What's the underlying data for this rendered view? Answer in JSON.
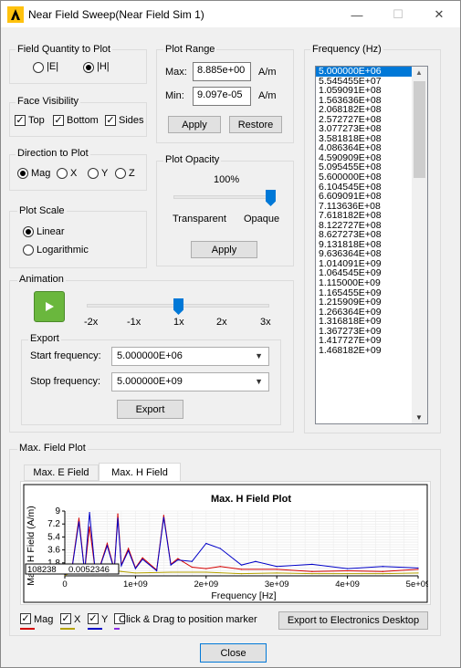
{
  "window": {
    "title": "Near Field Sweep(Near Field Sim 1)",
    "minimize": "—",
    "maximize": "☐",
    "close": "✕"
  },
  "field_quantity": {
    "title": "Field Quantity to Plot",
    "options": [
      "|E|",
      "|H|"
    ],
    "selected": "|H|"
  },
  "face_visibility": {
    "title": "Face Visibility",
    "options": [
      "Top",
      "Bottom",
      "Sides"
    ]
  },
  "direction": {
    "title": "Direction to Plot",
    "options": [
      "Mag",
      "X",
      "Y",
      "Z"
    ],
    "selected": "Mag"
  },
  "plot_scale": {
    "title": "Plot Scale",
    "options": [
      "Linear",
      "Logarithmic"
    ],
    "selected": "Linear"
  },
  "plot_range": {
    "title": "Plot Range",
    "max_label": "Max:",
    "max_value": "8.885e+00",
    "min_label": "Min:",
    "min_value": "9.097e-05",
    "unit": "A/m",
    "apply": "Apply",
    "restore": "Restore"
  },
  "plot_opacity": {
    "title": "Plot Opacity",
    "percent": "100%",
    "level": 1.0,
    "left_label": "Transparent",
    "right_label": "Opaque",
    "apply": "Apply"
  },
  "animation": {
    "title": "Animation",
    "speed_labels": [
      "-2x",
      "-1x",
      "1x",
      "2x",
      "3x"
    ],
    "speed": "1x",
    "export_title": "Export",
    "start_label": "Start frequency:",
    "start_value": "5.000000E+06",
    "stop_label": "Stop frequency:",
    "stop_value": "5.000000E+09",
    "export_button": "Export"
  },
  "frequency": {
    "title": "Frequency (Hz)",
    "items": [
      "5.000000E+06",
      "5.545455E+07",
      "1.059091E+08",
      "1.563636E+08",
      "2.068182E+08",
      "2.572727E+08",
      "3.077273E+08",
      "3.581818E+08",
      "4.086364E+08",
      "4.590909E+08",
      "5.095455E+08",
      "5.600000E+08",
      "6.104545E+08",
      "6.609091E+08",
      "7.113636E+08",
      "7.618182E+08",
      "8.122727E+08",
      "8.627273E+08",
      "9.131818E+08",
      "9.636364E+08",
      "1.014091E+09",
      "1.064545E+09",
      "1.115000E+09",
      "1.165455E+09",
      "1.215909E+09",
      "1.266364E+09",
      "1.316818E+09",
      "1.367273E+09",
      "1.417727E+09",
      "1.468182E+09"
    ],
    "selected_index": 0
  },
  "max_field": {
    "title": "Max. Field Plot",
    "tabs": [
      "Max. E Field",
      "Max. H Field"
    ],
    "active_tab": "Max. H Field",
    "legend": [
      {
        "label": "Mag",
        "color": "#d40000"
      },
      {
        "label": "X",
        "color": "#b5a200"
      },
      {
        "label": "Y",
        "color": "#0000c8"
      },
      {
        "label": "Click & Drag to position marker",
        "color": "#8a2be2"
      }
    ],
    "export_button": "Export to Electronics Desktop",
    "marker_readout": "0.0052346",
    "marker_x": "108238"
  },
  "chart_data": {
    "type": "line",
    "title": "Max. H Field Plot",
    "xlabel": "Frequency [Hz]",
    "ylabel": "Max. H Field (A/m)",
    "xlim": [
      0,
      5000000000
    ],
    "ylim": [
      0,
      9
    ],
    "x_ticks": [
      "0",
      "1e+09",
      "2e+09",
      "3e+09",
      "4e+09",
      "5e+09"
    ],
    "y_ticks": [
      "1.8",
      "3.6",
      "5.4",
      "7.2",
      "9"
    ],
    "grid": true,
    "series": [
      {
        "name": "Mag",
        "color": "#d40000",
        "x": [
          5000000.0,
          100000000.0,
          200000000.0,
          280000000.0,
          350000000.0,
          430000000.0,
          500000000.0,
          600000000.0,
          700000000.0,
          750000000.0,
          800000000.0,
          900000000.0,
          1000000000.0,
          1100000000.0,
          1300000000.0,
          1400000000.0,
          1500000000.0,
          1600000000.0,
          1800000000.0,
          2000000000.0,
          2200000000.0,
          2500000000.0,
          3000000000.0,
          3500000000.0,
          4000000000.0,
          4500000000.0,
          5000000000.0
        ],
        "y": [
          0.3,
          1.0,
          8.0,
          0.6,
          6.8,
          0.8,
          1.4,
          4.5,
          0.9,
          8.6,
          1.5,
          3.8,
          1.1,
          2.5,
          0.8,
          8.4,
          1.6,
          2.4,
          1.2,
          1.0,
          1.3,
          0.9,
          0.9,
          0.6,
          0.7,
          0.6,
          0.9
        ]
      },
      {
        "name": "X",
        "color": "#b5a200",
        "x": [
          5000000.0,
          200000000.0,
          400000000.0,
          600000000.0,
          800000000.0,
          1000000000.0,
          1500000000.0,
          2000000000.0,
          2500000000.0,
          3000000000.0,
          3500000000.0,
          4000000000.0,
          4500000000.0,
          5000000000.0
        ],
        "y": [
          0.1,
          0.8,
          0.5,
          0.9,
          0.6,
          0.4,
          0.5,
          0.5,
          0.3,
          0.4,
          0.3,
          0.3,
          0.3,
          0.4
        ]
      },
      {
        "name": "Y",
        "color": "#0000c8",
        "x": [
          5000000.0,
          100000000.0,
          200000000.0,
          280000000.0,
          350000000.0,
          430000000.0,
          500000000.0,
          600000000.0,
          700000000.0,
          750000000.0,
          800000000.0,
          900000000.0,
          1000000000.0,
          1100000000.0,
          1300000000.0,
          1400000000.0,
          1500000000.0,
          1600000000.0,
          1800000000.0,
          2000000000.0,
          2200000000.0,
          2500000000.0,
          2700000000.0,
          3000000000.0,
          3500000000.0,
          4000000000.0,
          4500000000.0,
          5000000000.0
        ],
        "y": [
          0.2,
          0.9,
          7.5,
          0.5,
          8.8,
          0.7,
          1.3,
          4.2,
          0.8,
          8.0,
          1.4,
          3.5,
          1.0,
          2.3,
          0.7,
          8.1,
          1.5,
          2.2,
          2.0,
          4.5,
          3.8,
          1.5,
          2.0,
          1.3,
          1.6,
          1.0,
          1.3,
          1.1
        ]
      }
    ]
  }
}
